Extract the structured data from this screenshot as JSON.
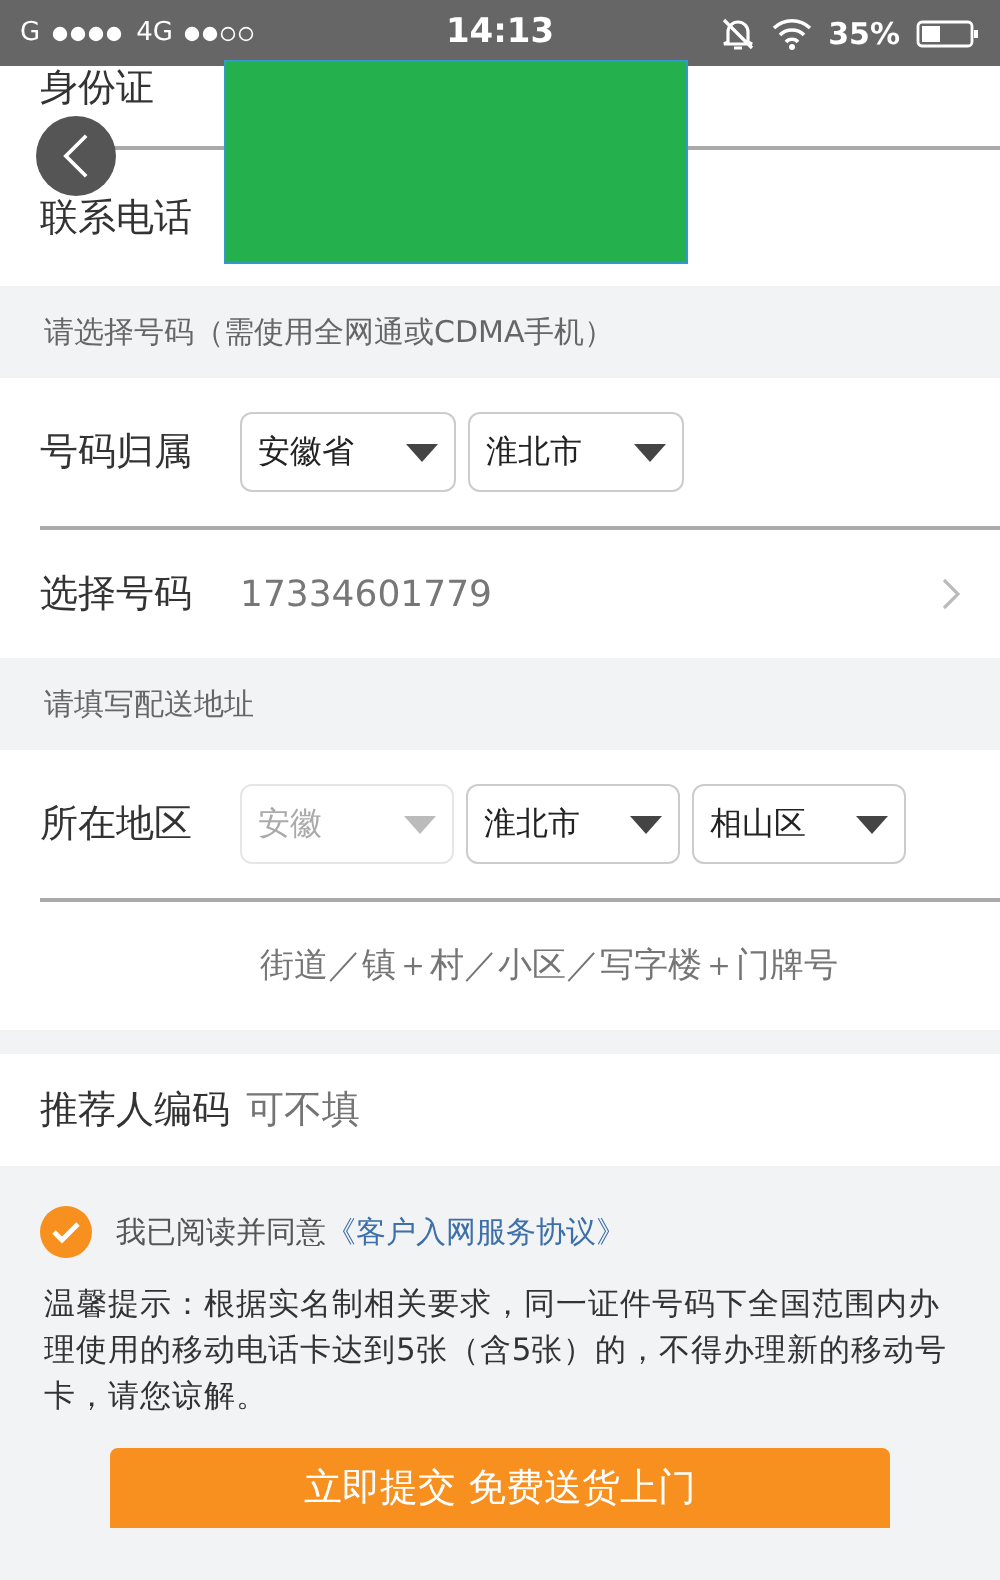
{
  "status_bar": {
    "carrier": "G",
    "network": "4G",
    "time": "14:13",
    "battery": "35%"
  },
  "identity": {
    "rows": [
      {
        "label": "身份证"
      },
      {
        "label": "联系电话"
      }
    ]
  },
  "number_section": {
    "header": "请选择号码（需使用全网通或CDMA手机）",
    "ownership": {
      "label": "号码归属",
      "selects": [
        {
          "value": "安徽省",
          "disabled": false
        },
        {
          "value": "淮北市",
          "disabled": false
        }
      ]
    },
    "choose": {
      "label": "选择号码",
      "value": "17334601779"
    }
  },
  "address_section": {
    "header": "请填写配送地址",
    "region": {
      "label": "所在地区",
      "selects": [
        {
          "value": "安徽",
          "disabled": true
        },
        {
          "value": "淮北市",
          "disabled": false
        },
        {
          "value": "相山区",
          "disabled": false
        }
      ]
    },
    "street": {
      "placeholder": "街道／镇＋村／小区／写字楼＋门牌号"
    }
  },
  "referrer": {
    "label": "推荐人编码",
    "placeholder": "可不填"
  },
  "agreement": {
    "checked": true,
    "text": "我已阅读并同意",
    "link": "《客户入网服务协议》"
  },
  "notice": "温馨提示：根据实名制相关要求，同一证件号码下全国范围内办理使用的移动电话卡达到5张（含5张）的，不得办理新的移动号卡，请您谅解。",
  "submit": "立即提交 免费送货上门"
}
